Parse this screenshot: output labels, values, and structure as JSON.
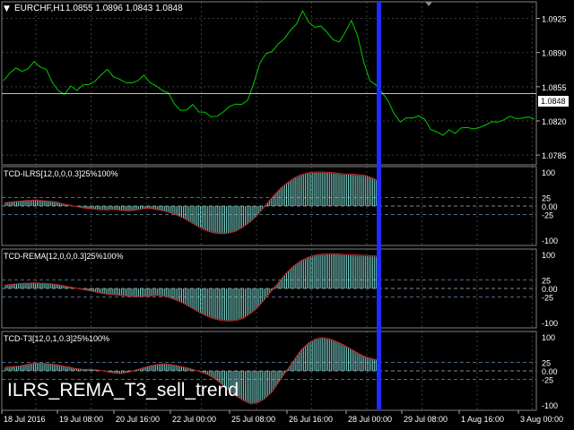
{
  "window": {
    "symbol_title": "EURCHF,H1",
    "ohlc": "1.0855 1.0896 1.0843 1.0848",
    "overlay_text": "ILRS_REMA_T3_sell_trend"
  },
  "colors": {
    "background": "#000000",
    "grid": "#3a3a3a",
    "price_line": "#00cc00",
    "histogram": "#7fd8d0",
    "signal_line": "#cc2222",
    "vertical_marker": "#1f2bff",
    "text": "#ffffff"
  },
  "price_panel": {
    "y_ticks": [
      "1.0925",
      "1.0890",
      "1.0855",
      "1.0820",
      "1.0785"
    ],
    "current_price_label": "1.0848",
    "current_price": 1.0848
  },
  "indicators": [
    {
      "name": "TCD-ILRS[12,0,0,0.3]25%100%",
      "y_ticks": [
        "100",
        "25",
        "0.00",
        "-25",
        "-100"
      ]
    },
    {
      "name": "TCD-REMA[12,0,0,0.3]25%100%",
      "y_ticks": [
        "100",
        "25",
        "0.00",
        "-25",
        "-100"
      ]
    },
    {
      "name": "TCD-T3[12,0,1,0.3]25%100%",
      "y_ticks": [
        "100",
        "25",
        "0.00",
        "-25",
        "-100"
      ]
    }
  ],
  "time_axis": [
    "18 Jul 2016",
    "19 Jul 08:00",
    "20 Jul 16:00",
    "22 Jul 00:00",
    "25 Jul 08:00",
    "26 Jul 16:00",
    "28 Jul 00:00",
    "29 Jul 08:00",
    "1 Aug 16:00",
    "3 Aug 00:00"
  ],
  "chart_data": {
    "type": "line",
    "price_series": [
      1.0862,
      1.0868,
      1.0875,
      1.087,
      1.0874,
      1.088,
      1.0876,
      1.0872,
      1.086,
      1.085,
      1.0848,
      1.0855,
      1.0852,
      1.0856,
      1.0858,
      1.086,
      1.0868,
      1.0872,
      1.0866,
      1.0862,
      1.086,
      1.0858,
      1.0862,
      1.0866,
      1.086,
      1.0855,
      1.0852,
      1.0848,
      1.0838,
      1.083,
      1.0832,
      1.0836,
      1.083,
      1.0828,
      1.0825,
      1.0824,
      1.083,
      1.0834,
      1.0838,
      1.0836,
      1.0842,
      1.0858,
      1.088,
      1.0888,
      1.0892,
      1.0898,
      1.0905,
      1.0912,
      1.092,
      1.0932,
      1.0922,
      1.0915,
      1.0918,
      1.091,
      1.0904,
      1.09,
      1.0912,
      1.0922,
      1.0908,
      1.088,
      1.0862,
      1.0856,
      1.085,
      1.084,
      1.0828,
      1.0818,
      1.0824,
      1.0822,
      1.0826,
      1.0821,
      1.0812,
      1.0808,
      1.0806,
      1.081,
      1.0808,
      1.0812,
      1.0814,
      1.0811,
      1.0814,
      1.0815,
      1.082,
      1.0818,
      1.0822,
      1.0824,
      1.0823,
      1.0822,
      1.0825,
      1.0821
    ],
    "histogram_series": {
      "ilrs": [
        10,
        12,
        14,
        16,
        17,
        16,
        14,
        12,
        6,
        2,
        -2,
        -6,
        -8,
        -10,
        -11,
        -10,
        -12,
        -14,
        -12,
        -8,
        -6,
        -10,
        -14,
        -20,
        -28,
        -38,
        -50,
        -62,
        -72,
        -78,
        -80,
        -78,
        -72,
        -60,
        -45,
        -25,
        0,
        25,
        48,
        65,
        80,
        90,
        96,
        98,
        98,
        97,
        95,
        92,
        92,
        90,
        88,
        80,
        70
      ],
      "rema": [
        10,
        12,
        14,
        15,
        16,
        15,
        14,
        12,
        8,
        4,
        0,
        -4,
        -8,
        -12,
        -16,
        -18,
        -20,
        -22,
        -24,
        -24,
        -22,
        -20,
        -22,
        -28,
        -36,
        -46,
        -58,
        -70,
        -80,
        -88,
        -92,
        -94,
        -92,
        -86,
        -72,
        -55,
        -30,
        -5,
        20,
        45,
        65,
        80,
        90,
        96,
        99,
        100,
        100,
        98,
        97,
        96,
        95,
        94,
        92
      ],
      "t3": [
        10,
        12,
        14,
        18,
        22,
        22,
        20,
        18,
        14,
        10,
        6,
        4,
        4,
        2,
        -2,
        -6,
        -8,
        -4,
        2,
        8,
        14,
        18,
        20,
        18,
        14,
        10,
        4,
        -2,
        -10,
        -22,
        -38,
        -55,
        -72,
        -85,
        -95,
        -92,
        -80,
        -60,
        -30,
        0,
        30,
        60,
        80,
        92,
        96,
        92,
        84,
        74,
        62,
        50,
        40,
        34,
        30
      ]
    }
  }
}
